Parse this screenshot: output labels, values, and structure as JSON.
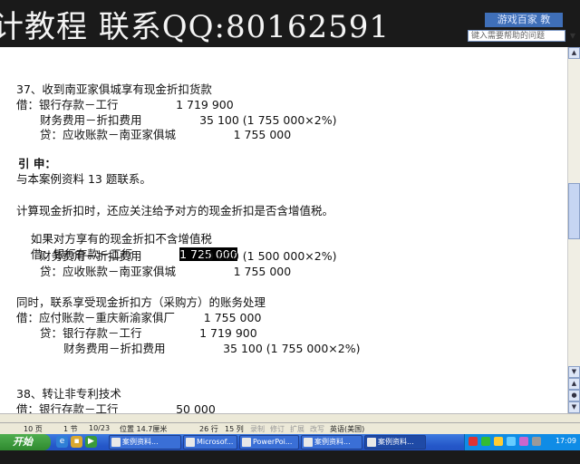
{
  "watermark": {
    "text": "计教程 联系QQ:80162591",
    "right_label": "游戏百家 教"
  },
  "help_box": {
    "placeholder": "键入需要帮助的问题"
  },
  "document": {
    "lines": {
      "l1": "37、收到南亚家俱城享有现金折扣货款",
      "l2": "借：银行存款－工行                1 719 900",
      "l3": "财务费用－折扣费用                35 100 (1 755 000×2%)",
      "l4": "贷：应收账款－南亚家俱城                1 755 000",
      "l5": "引 申：",
      "l6": "与本案例资料 13 题联系。",
      "l7": "计算现金折扣时，还应关注给予对方的现金折扣是否含增值税。",
      "l8": "如果对方享有的现金折扣不含增值税",
      "l9a": "借：银行存款－工行             ",
      "l9b": "1 725 000",
      "l10": "财务费用－折扣费用                30 000 (1 500 000×2%)",
      "l11": "贷：应收账款－南亚家俱城                1 755 000",
      "l12": "同时，联系享受现金折扣方（采购方）的账务处理",
      "l13": "借：应付账款－重庆新渝家俱厂        1 755 000",
      "l14": "贷：银行存款－工行                1 719 900",
      "l15": "财务费用－折扣费用                35 100 (1 755 000×2%)",
      "l16": "38、转让非专利技术",
      "l17": "借：银行存款－工行                50 000"
    }
  },
  "status": {
    "page": "10 页",
    "section": "1 节",
    "page_of": "10/23",
    "position": "位置 14.7厘米",
    "row": "26 行",
    "col": "15 列",
    "rec": "录制",
    "rev": "修订",
    "ext": "扩展",
    "ovr": "改写",
    "lang": "英语(美国)"
  },
  "taskbar": {
    "start": "开始",
    "tasks": [
      "案例资料...",
      "Microsof...",
      "PowerPoi...",
      "案例资料...",
      "案例资料..."
    ],
    "clock": "17:09"
  },
  "colors": {
    "taskbar": "#2456c8",
    "start": "#3a9a3a",
    "highlight": "#000000"
  }
}
